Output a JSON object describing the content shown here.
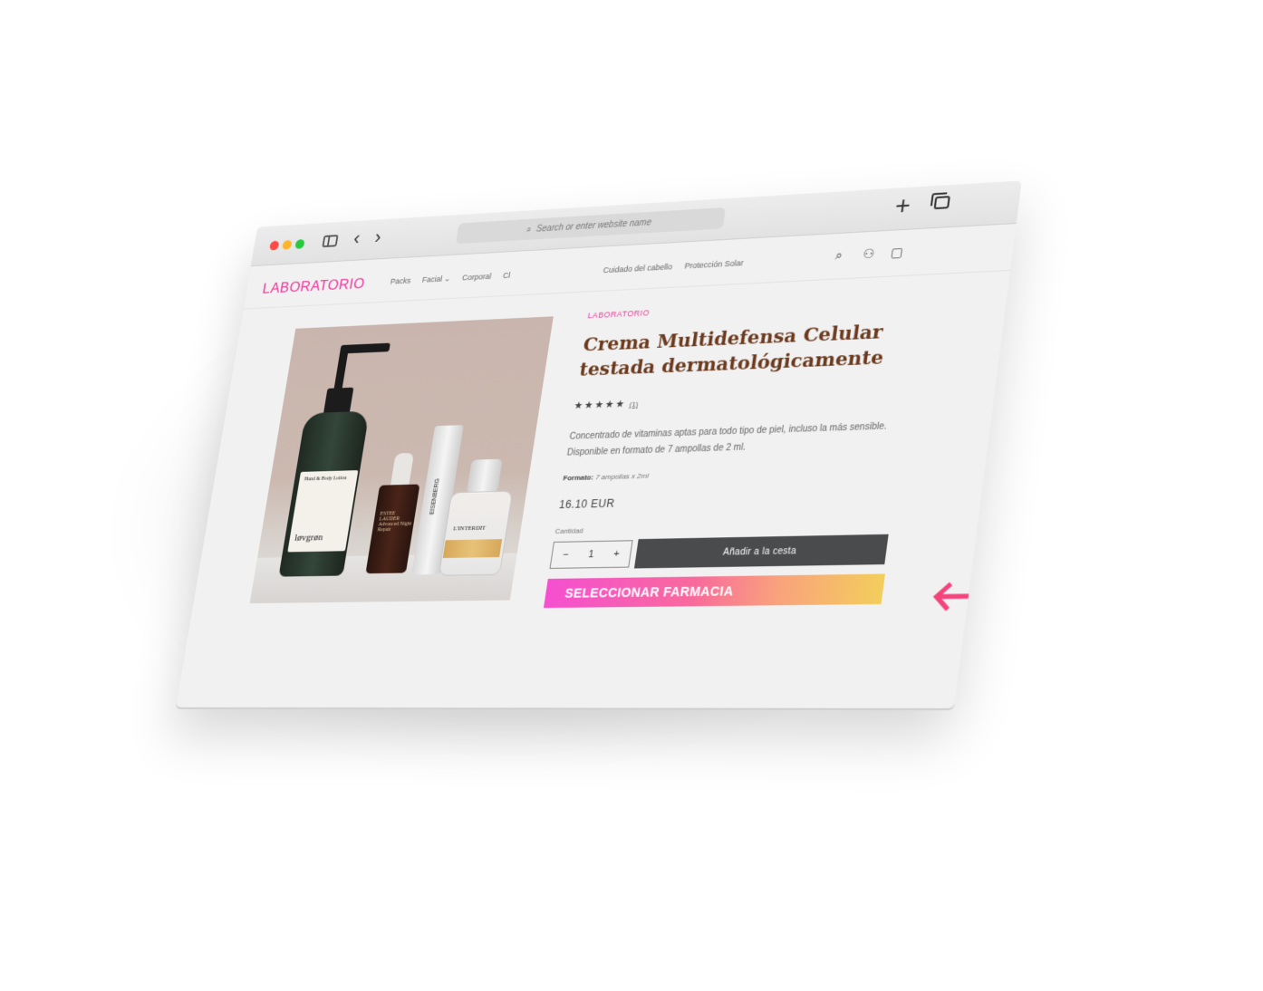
{
  "browser": {
    "address_placeholder": "Search or enter website name",
    "plus_label": "+",
    "back_label": "‹",
    "forward_label": "›"
  },
  "store": {
    "logo": "LABORATORIO",
    "menu_left": [
      "Packs",
      "Facial",
      "Corporal",
      "Cl"
    ],
    "menu_right": [
      "Cuidado del cabello",
      "Protección Solar"
    ],
    "icons": [
      "search-icon",
      "user-icon",
      "cart-icon"
    ]
  },
  "product": {
    "brand": "LABORATORIO",
    "title_line1": "Crema Multidefensa Celular",
    "title_line2": "testada dermatológicamente",
    "stars": "★★★★★",
    "review_count": "(1)",
    "description": "Concentrado de vitaminas aptas para todo tipo de piel, incluso la más sensible. Disponible en formato de 7 ampollas de 2 ml.",
    "format_label": "Formato:",
    "format_value": "7 ampollas x 2ml",
    "price": "16.10 EUR",
    "quantity_label": "Cantidad",
    "quantity_value": "1",
    "minus_label": "−",
    "plus_label": "+",
    "add_to_cart": "Añadir a la cesta",
    "select_pharmacy": "SELECCIONAR FARMACIA",
    "image_texts": {
      "lotion_label_title": "Hand & Body Lotion",
      "lotion_brand": "løvgrøn",
      "serum_brand": "ESTEE LAUDER",
      "serum_name": "Advanced Night Repair",
      "tube_brand": "EISENBERG",
      "perfume_name": "L'INTERDIT"
    }
  },
  "colors": {
    "brand_pink": "#f0349c",
    "title_brown": "#6b3a1e",
    "button_dark": "#4a4b4d",
    "arrow_pink": "#f5447c"
  }
}
